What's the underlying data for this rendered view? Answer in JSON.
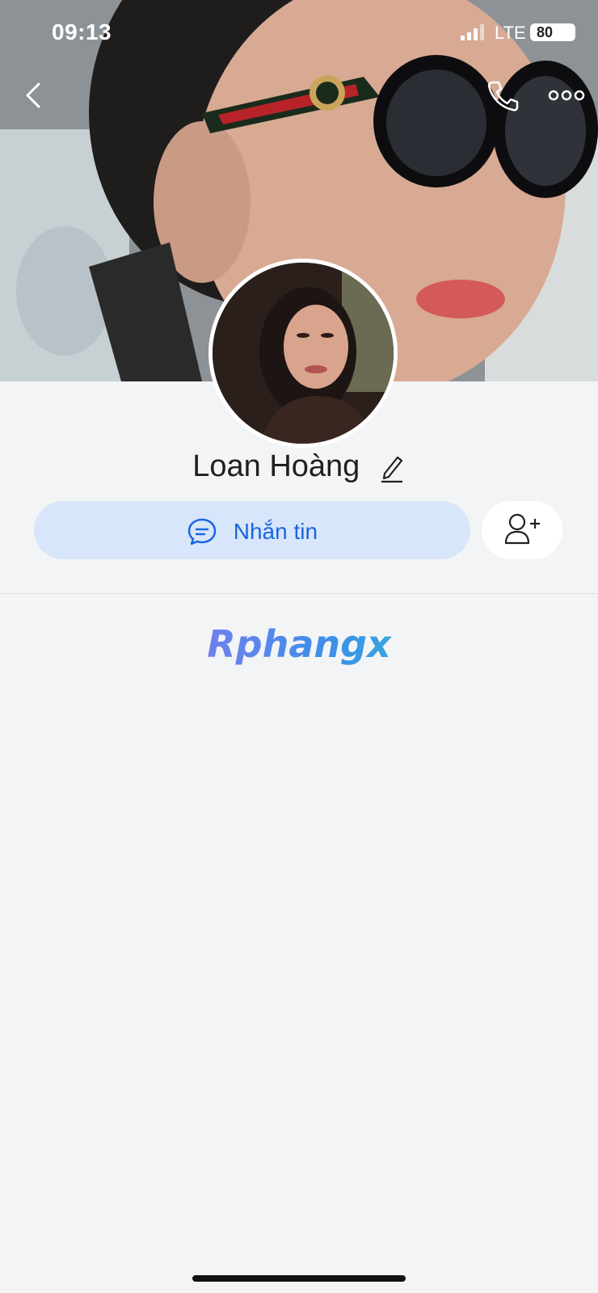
{
  "status_bar": {
    "time": "09:13",
    "network": "LTE",
    "battery": "80"
  },
  "profile": {
    "name": "Loan Hoàng"
  },
  "actions": {
    "message_label": "Nhắn tin"
  },
  "watermark": {
    "text": "Rphangx"
  },
  "colors": {
    "accent": "#1a66e0",
    "button_bg": "#d8e6fb",
    "page_bg": "#f3f4f6"
  },
  "icons": [
    "back-icon",
    "phone-icon",
    "more-icon",
    "edit-icon",
    "chat-icon",
    "add-friend-icon"
  ]
}
